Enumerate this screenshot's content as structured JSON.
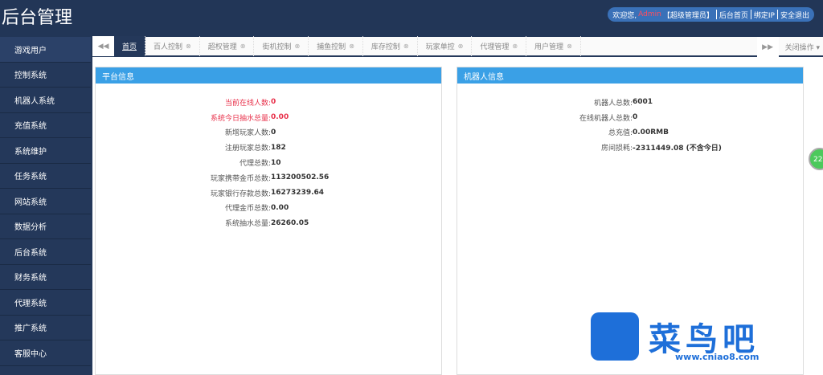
{
  "header": {
    "title": "后台管理",
    "welcome": "欢迎您,",
    "user": "Admin",
    "role": "【超级管理员】",
    "links": [
      "后台首页",
      "绑定IP",
      "安全退出"
    ]
  },
  "sidebar": {
    "items": [
      "游戏用户",
      "控制系统",
      "机器人系统",
      "充值系统",
      "系统维护",
      "任务系统",
      "网站系统",
      "数据分析",
      "后台系统",
      "财务系统",
      "代理系统",
      "推广系统",
      "客服中心"
    ]
  },
  "tabs": {
    "items": [
      "首页",
      "百人控制",
      "超权管理",
      "街机控制",
      "捕鱼控制",
      "库存控制",
      "玩家单控",
      "代理管理",
      "用户管理"
    ],
    "close_ops": "关闭操作"
  },
  "platform": {
    "title": "平台信息",
    "rows": [
      {
        "k": "当前在线人数:",
        "v": "0",
        "red": true
      },
      {
        "k": "系统今日抽水总量:",
        "v": "0.00",
        "red": true
      },
      {
        "k": "新增玩家人数:",
        "v": "0"
      },
      {
        "k": "注册玩家总数:",
        "v": "182"
      },
      {
        "k": "代理总数:",
        "v": "10"
      },
      {
        "k": "玩家携带金币总数:",
        "v": "113200502.56"
      },
      {
        "k": "玩家银行存款总数:",
        "v": "16273239.64"
      },
      {
        "k": "代理金币总数:",
        "v": "0.00"
      },
      {
        "k": "系统抽水总量:",
        "v": "26260.05"
      }
    ]
  },
  "robot": {
    "title": "机器人信息",
    "rows": [
      {
        "k": "机器人总数:",
        "v": "6001"
      },
      {
        "k": "在线机器人总数:",
        "v": "0"
      },
      {
        "k": "总充值:",
        "v": "0.00RMB"
      },
      {
        "k": "房间损耗:",
        "v": "-2311449.08 (不含今日)"
      }
    ]
  },
  "bubble": "22",
  "watermark": {
    "text": "菜鸟吧",
    "url": "www.cniao8.com"
  }
}
